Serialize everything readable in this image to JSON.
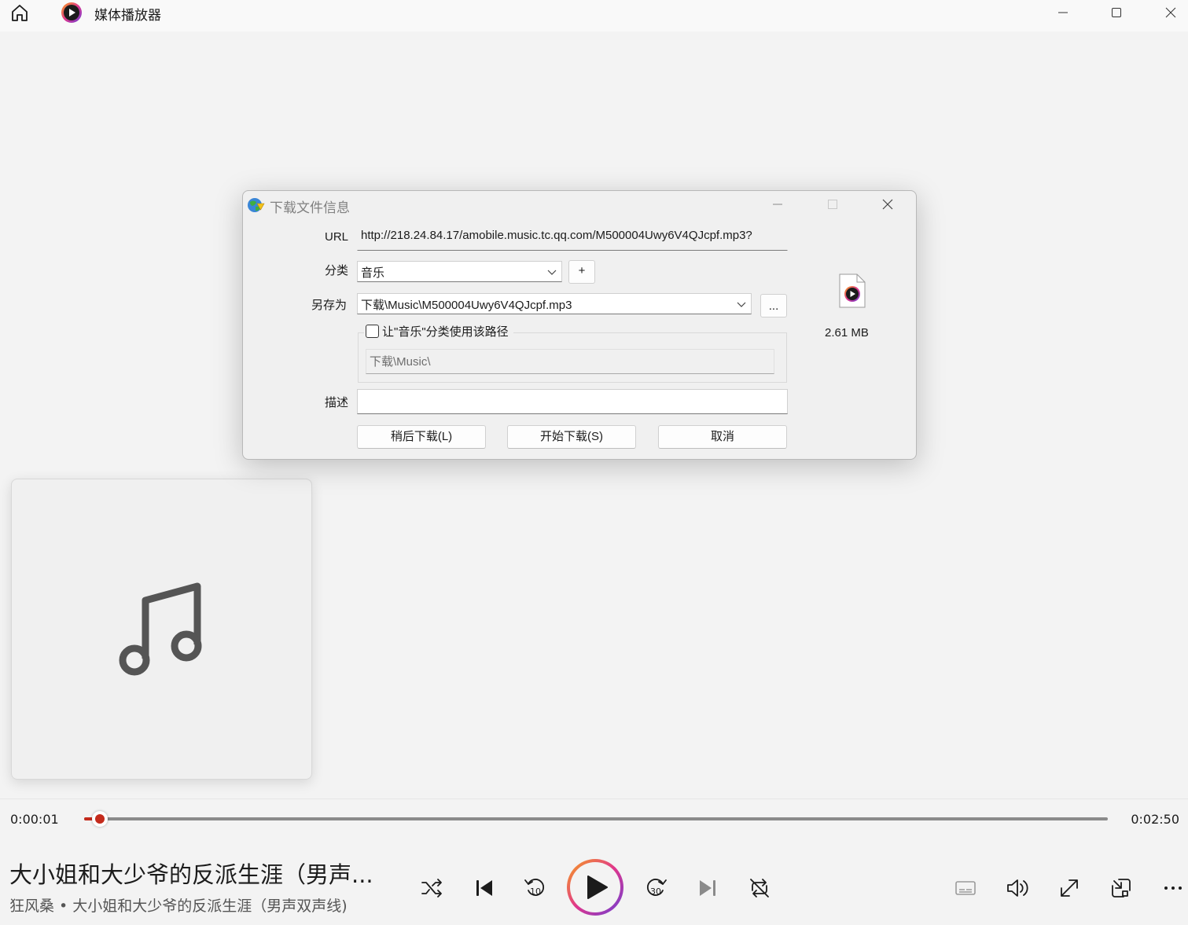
{
  "app": {
    "title": "媒体播放器"
  },
  "dialog": {
    "title": "下载文件信息",
    "url_label": "URL",
    "url_value": "http://218.24.84.17/amobile.music.tc.qq.com/M500004Uwy6V4QJcpf.mp3?",
    "category_label": "分类",
    "category_value": "音乐",
    "add_category_button": "+",
    "save_as_label": "另存为",
    "save_as_value": "下载\\Music\\M500004Uwy6V4QJcpf.mp3",
    "browse_button": "...",
    "checkbox_label": "让\"音乐\"分类使用该路径",
    "category_path": "下载\\Music\\",
    "description_label": "描述",
    "description_value": "",
    "file_size": "2.61  MB",
    "buttons": {
      "later": "稍后下载(L)",
      "start": "开始下载(S)",
      "cancel": "取消"
    }
  },
  "player": {
    "current_time": "0:00:01",
    "total_time": "0:02:50",
    "progress": 0.0012,
    "song_title": "大小姐和大少爷的反派生涯（男声...",
    "song_subtitle": "狂风桑 • 大小姐和大少爷的反派生涯（男声双声线)",
    "accent_color": "#c42b1c",
    "icons": [
      "shuffle-icon",
      "previous-icon",
      "rewind-10-icon",
      "play-icon",
      "forward-30-icon",
      "next-icon",
      "repeat-off-icon",
      "captions-icon",
      "volume-icon",
      "fullscreen-icon",
      "mini-player-icon",
      "more-icon"
    ]
  }
}
